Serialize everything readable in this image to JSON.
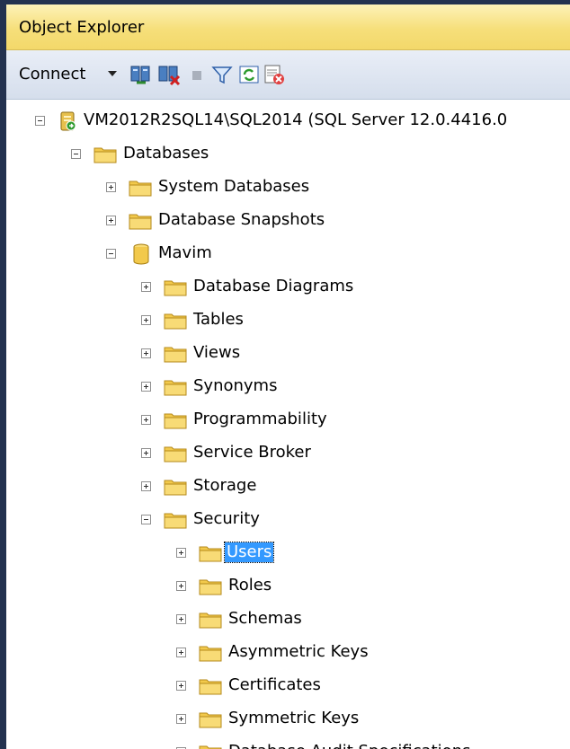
{
  "panel": {
    "title": "Object Explorer",
    "toolbar": {
      "connect_label": "Connect",
      "icons": [
        "connect-server-icon",
        "disconnect-server-icon",
        "stop-icon",
        "filter-icon",
        "refresh-icon",
        "activity-monitor-icon"
      ]
    }
  },
  "tree": {
    "server": "VM2012R2SQL14\\SQL2014 (SQL Server 12.0.4416.0",
    "databases": "Databases",
    "system_databases": "System Databases",
    "database_snapshots": "Database Snapshots",
    "db": "Mavim",
    "db_children": {
      "diagrams": "Database Diagrams",
      "tables": "Tables",
      "views": "Views",
      "synonyms": "Synonyms",
      "programmability": "Programmability",
      "service_broker": "Service Broker",
      "storage": "Storage",
      "security": "Security"
    },
    "security_children": {
      "users": "Users",
      "roles": "Roles",
      "schemas": "Schemas",
      "asymmetric_keys": "Asymmetric Keys",
      "certificates": "Certificates",
      "symmetric_keys": "Symmetric Keys",
      "audit_specs": "Database Audit Specifications"
    }
  },
  "colors": {
    "title_bar": "#f6df7a",
    "selection": "#3399ff",
    "folder": "#f2c94c"
  }
}
